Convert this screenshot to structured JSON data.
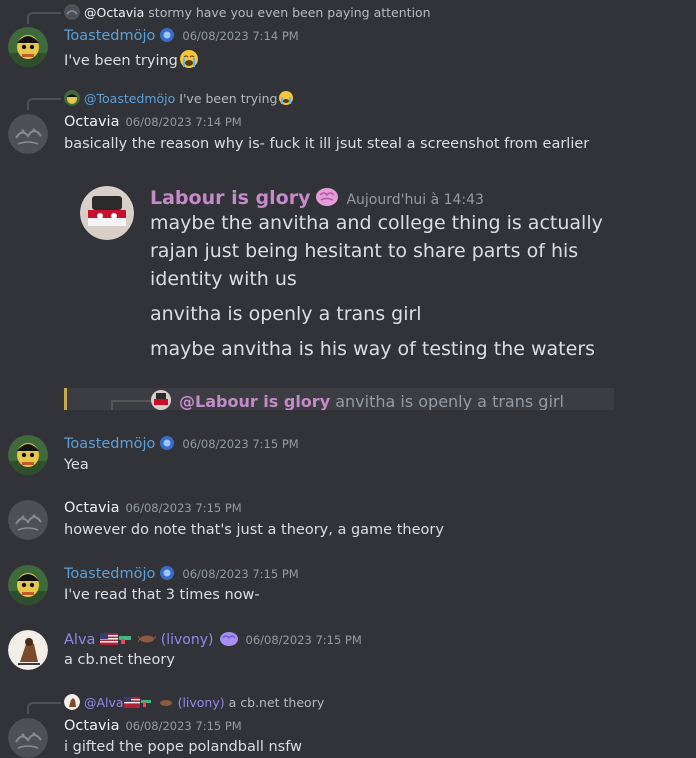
{
  "messages": [
    {
      "id": "m1",
      "reply": {
        "author": "@Octavia",
        "text": "stormy have you even been paying attention"
      },
      "author": "Toastedmöjo",
      "timestamp": "06/08/2023 7:14 PM",
      "text": "I've been trying"
    },
    {
      "id": "m2",
      "reply": {
        "author": "@Toastedmöjo",
        "text": "I've been trying"
      },
      "author": "Octavia",
      "timestamp": "06/08/2023 7:14 PM",
      "text": "basically the reason why is- fuck it ill jsut steal a screenshot from earlier"
    },
    {
      "id": "m3",
      "author": "Toastedmöjo",
      "timestamp": "06/08/2023 7:15 PM",
      "text": "Yea"
    },
    {
      "id": "m4",
      "author": "Octavia",
      "timestamp": "06/08/2023 7:15 PM",
      "text": "however do note that's just a theory, a game theory"
    },
    {
      "id": "m5",
      "author": "Toastedmöjo",
      "timestamp": "06/08/2023 7:15 PM",
      "text": "I've read that 3 times now-"
    },
    {
      "id": "m6",
      "author": "Alva",
      "author_suffix": "(livony)",
      "timestamp": "06/08/2023 7:15 PM",
      "text": "a cb.net theory"
    },
    {
      "id": "m7",
      "reply": {
        "author": "@Alva",
        "author_suffix": "(livony)",
        "text": "a cb.net theory"
      },
      "author": "Octavia",
      "timestamp": "06/08/2023 7:15 PM",
      "text": "i gifted the pope polandball nsfw"
    }
  ],
  "screenshot": {
    "author": "Labour is glory",
    "timestamp": "Aujourd'hui à 14:43",
    "lines": [
      "maybe the anvitha and college thing is actually",
      "rajan just being hesitant to share parts of his",
      "identity with us",
      "anvitha is openly a trans girl",
      "maybe anvitha is his way of testing the waters"
    ],
    "quote_author": "@Labour is glory",
    "quote_text": "anvitha is openly a trans girl"
  },
  "colors": {
    "background": "#313338",
    "toastedmojo": "#5e9fd6",
    "alva": "#9b84ec",
    "labour": "#c58ac9",
    "timestamp": "#949ba4"
  }
}
